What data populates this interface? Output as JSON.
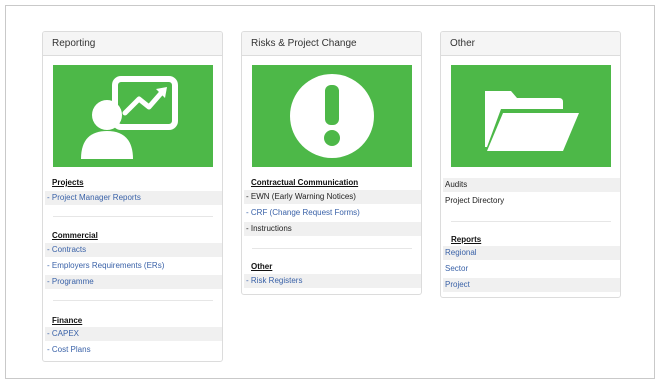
{
  "panels": {
    "reporting": {
      "title": "Reporting",
      "icon": "presentation-user-chart-icon",
      "sections": {
        "projects": {
          "title": "Projects",
          "items": [
            "- Project Manager Reports"
          ]
        },
        "commercial": {
          "title": "Commercial",
          "items": [
            "- Contracts",
            "- Employers Requirements (ERs)",
            "- Programme"
          ]
        },
        "finance": {
          "title": "Finance",
          "items": [
            "- CAPEX",
            "- Cost Plans"
          ]
        }
      }
    },
    "risks": {
      "title": "Risks & Project Change",
      "icon": "exclamation-circle-icon",
      "sections": {
        "contractual": {
          "title": "Contractual Communication",
          "items": [
            "- EWN (Early Warning Notices)",
            "- CRF (Change Request Forms)",
            "- Instructions"
          ]
        },
        "other": {
          "title": "Other",
          "items": [
            "- Risk Registers"
          ]
        }
      }
    },
    "other": {
      "title": "Other",
      "icon": "folder-open-icon",
      "top_items": [
        "Audits",
        "Project Directory"
      ],
      "sections": {
        "reports": {
          "title": "Reports",
          "items": [
            "Regional",
            "Sector",
            "Project"
          ]
        }
      }
    }
  },
  "colors": {
    "tile_green": "#4db848",
    "link": "#3a62a8",
    "row_shade": "#f0f0f0"
  }
}
